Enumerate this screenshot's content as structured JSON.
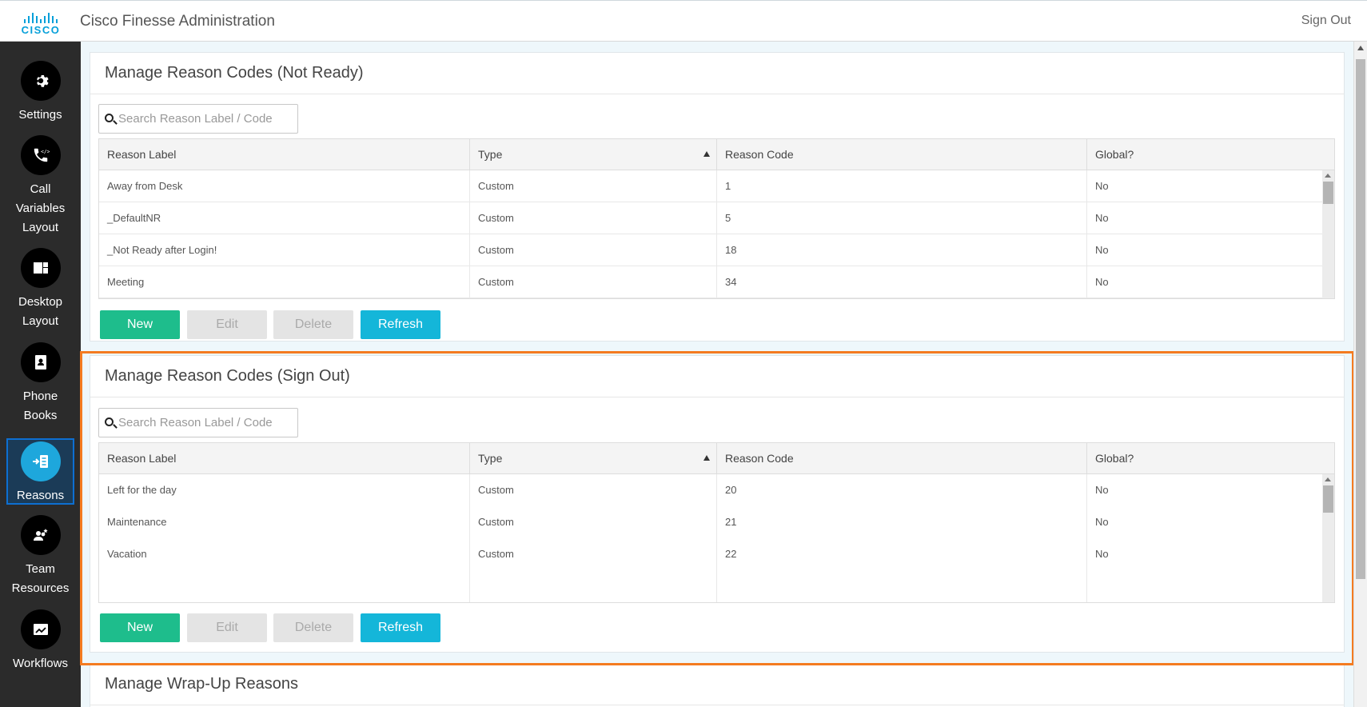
{
  "header": {
    "logo_text": "CISCO",
    "title": "Cisco Finesse Administration",
    "signout": "Sign Out"
  },
  "sidebar": {
    "items": [
      {
        "label": "Settings",
        "icon": "gear-icon"
      },
      {
        "label": "Call Variables Layout",
        "icon": "phone-code-icon"
      },
      {
        "label": "Desktop Layout",
        "icon": "layout-icon"
      },
      {
        "label": "Phone Books",
        "icon": "contact-book-icon"
      },
      {
        "label": "Reasons",
        "icon": "reasons-icon",
        "active": true
      },
      {
        "label": "Team Resources",
        "icon": "team-icon"
      },
      {
        "label": "Workflows",
        "icon": "workflow-icon"
      }
    ]
  },
  "not_ready": {
    "title": "Manage Reason Codes (Not Ready)",
    "search_placeholder": "Search Reason Label / Code",
    "columns": [
      "Reason Label",
      "Type",
      "Reason Code",
      "Global?"
    ],
    "rows": [
      [
        "Away from Desk",
        "Custom",
        "1",
        "No"
      ],
      [
        "_DefaultNR",
        "Custom",
        "5",
        "No"
      ],
      [
        "_Not Ready after Login!",
        "Custom",
        "18",
        "No"
      ],
      [
        "Meeting",
        "Custom",
        "34",
        "No"
      ]
    ],
    "buttons": {
      "new": "New",
      "edit": "Edit",
      "delete": "Delete",
      "refresh": "Refresh"
    }
  },
  "sign_out": {
    "title": "Manage Reason Codes (Sign Out)",
    "search_placeholder": "Search Reason Label / Code",
    "columns": [
      "Reason Label",
      "Type",
      "Reason Code",
      "Global?"
    ],
    "rows": [
      [
        "Left for the day",
        "Custom",
        "20",
        "No"
      ],
      [
        "Maintenance",
        "Custom",
        "21",
        "No"
      ],
      [
        "Vacation",
        "Custom",
        "22",
        "No"
      ]
    ],
    "buttons": {
      "new": "New",
      "edit": "Edit",
      "delete": "Delete",
      "refresh": "Refresh"
    }
  },
  "wrap_up": {
    "title": "Manage Wrap-Up Reasons"
  },
  "colors": {
    "accent_new": "#1ebd8c",
    "accent_refresh": "#14b6d9",
    "active_nav": "#1ea7dc",
    "highlight": "#f47b20"
  }
}
